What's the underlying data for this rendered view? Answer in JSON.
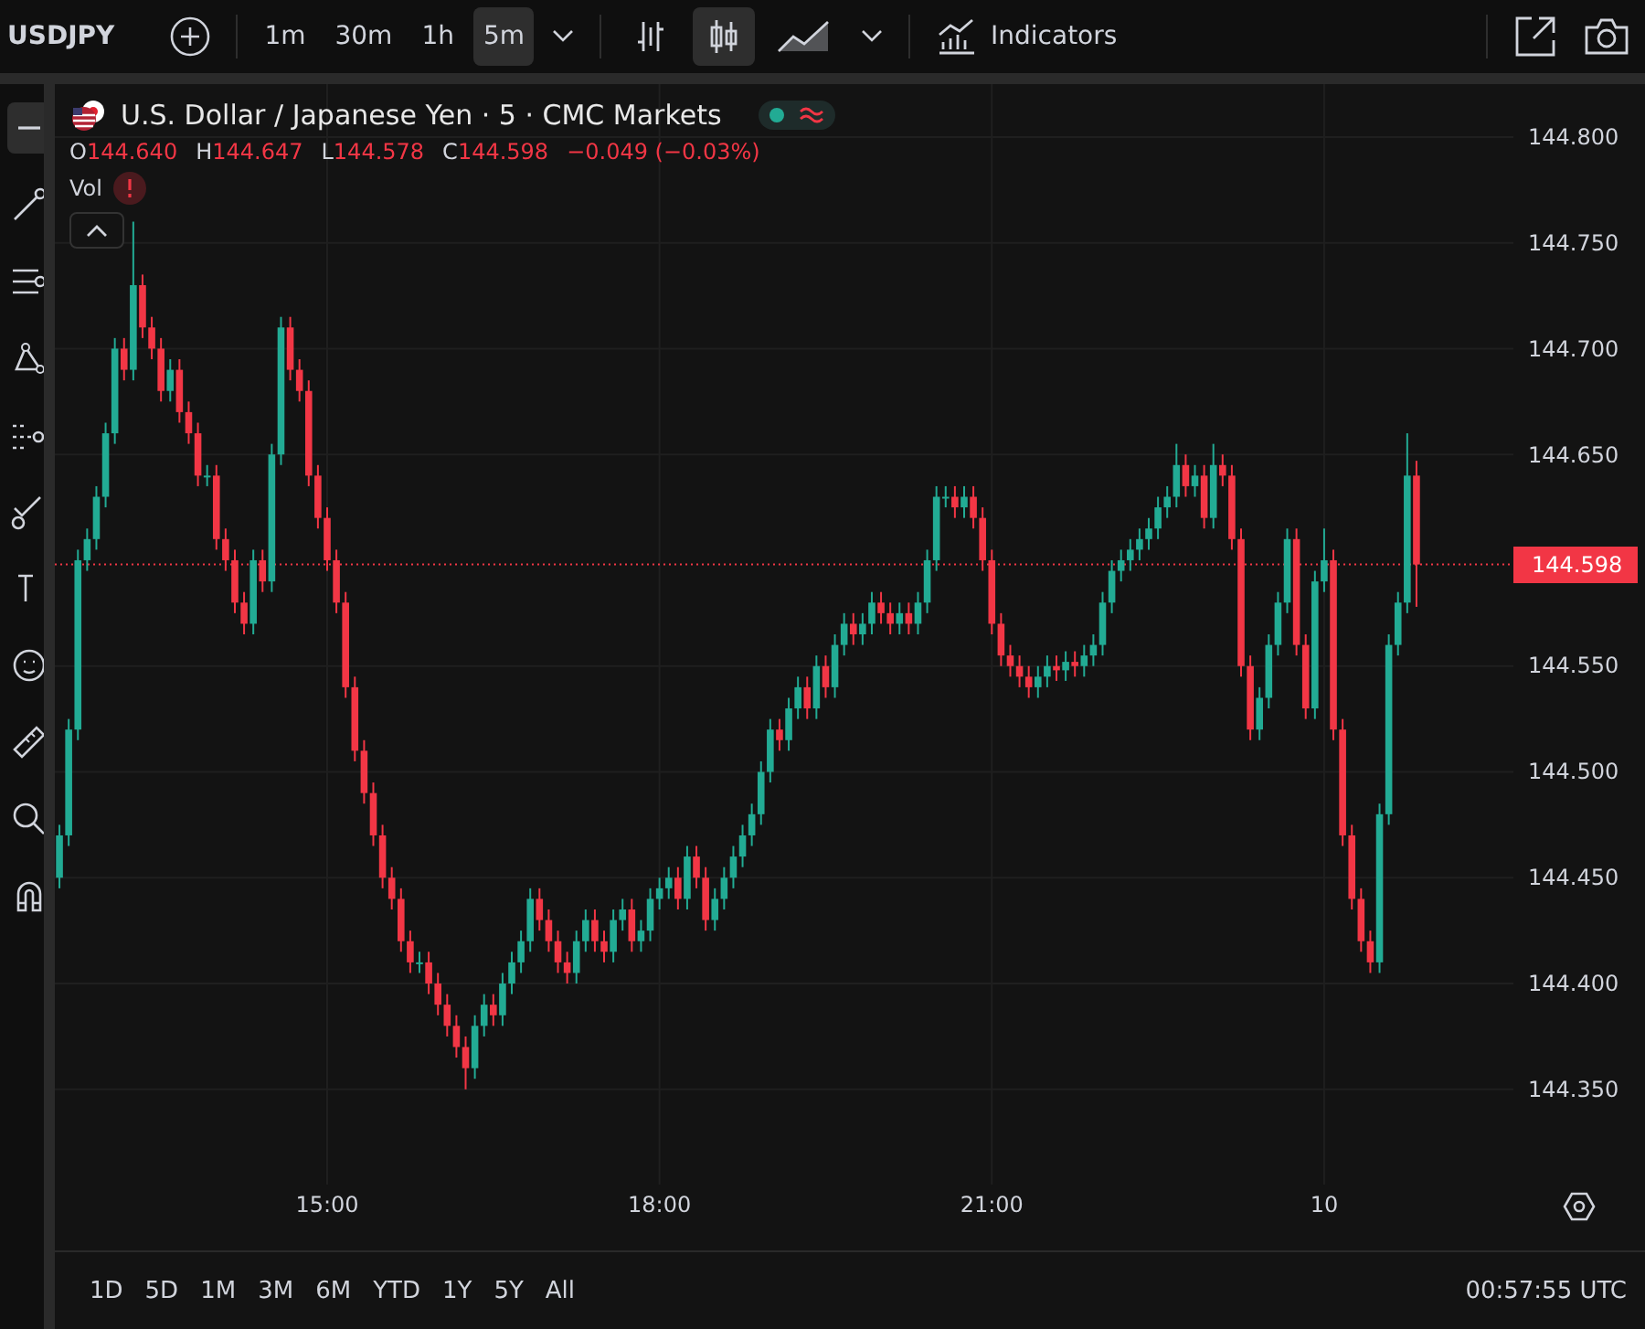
{
  "toolbar": {
    "symbol": "USDJPY",
    "intervals": [
      {
        "label": "1m",
        "selected": false
      },
      {
        "label": "30m",
        "selected": false
      },
      {
        "label": "1h",
        "selected": false
      },
      {
        "label": "5m",
        "selected": true
      }
    ],
    "chart_styles": [
      {
        "kind": "bars",
        "selected": false
      },
      {
        "kind": "candles",
        "selected": true
      },
      {
        "kind": "area",
        "selected": false
      }
    ],
    "indicators_label": "Indicators"
  },
  "sidebar": {
    "tools": [
      {
        "kind": "minus",
        "selected": true
      },
      {
        "kind": "line",
        "selected": false
      },
      {
        "kind": "fib",
        "selected": false
      },
      {
        "kind": "pattern",
        "selected": false
      },
      {
        "kind": "forecast",
        "selected": false
      },
      {
        "kind": "brush",
        "selected": false
      },
      {
        "kind": "text",
        "selected": false
      },
      {
        "kind": "emoji",
        "selected": false
      },
      {
        "kind": "ruler",
        "selected": false
      },
      {
        "kind": "zoom",
        "selected": false
      },
      {
        "kind": "magnet",
        "selected": false
      }
    ]
  },
  "legend": {
    "title": "U.S. Dollar / Japanese Yen · 5 · CMC Markets",
    "ohlc": [
      {
        "label": "O",
        "value": "144.640"
      },
      {
        "label": "H",
        "value": "144.647"
      },
      {
        "label": "L",
        "value": "144.578"
      },
      {
        "label": "C",
        "value": "144.598"
      }
    ],
    "change": "−0.049 (−0.03%)",
    "volume_label": "Vol"
  },
  "chart_data": {
    "type": "candlestick",
    "categories": [
      null,
      null,
      null,
      null,
      null,
      null,
      null,
      null,
      null,
      null,
      null,
      null,
      null,
      null,
      null,
      null,
      null,
      null,
      null,
      null,
      null,
      null,
      null,
      null,
      null,
      null,
      null,
      null,
      null,
      "15:00",
      null,
      null,
      null,
      null,
      null,
      null,
      null,
      null,
      null,
      null,
      null,
      null,
      null,
      null,
      null,
      null,
      null,
      null,
      null,
      null,
      null,
      null,
      null,
      null,
      null,
      null,
      null,
      null,
      null,
      null,
      null,
      null,
      null,
      null,
      null,
      "18:00",
      null,
      null,
      null,
      null,
      null,
      null,
      null,
      null,
      null,
      null,
      null,
      null,
      null,
      null,
      null,
      null,
      null,
      null,
      null,
      null,
      null,
      null,
      null,
      null,
      null,
      null,
      null,
      null,
      null,
      null,
      null,
      null,
      null,
      null,
      null,
      "21:00",
      null,
      null,
      null,
      null,
      null,
      null,
      null,
      null,
      null,
      null,
      null,
      null,
      null,
      null,
      null,
      null,
      null,
      null,
      null,
      null,
      null,
      null,
      null,
      null,
      null,
      null,
      null,
      null,
      null,
      null,
      null,
      null,
      null,
      null,
      null,
      "10",
      null,
      null,
      null,
      null,
      null,
      null,
      null,
      null,
      null,
      null
    ],
    "ohlc": [
      [
        144.45,
        144.475,
        144.445,
        144.47
      ],
      [
        144.47,
        144.525,
        144.465,
        144.52
      ],
      [
        144.52,
        144.605,
        144.515,
        144.6
      ],
      [
        144.6,
        144.615,
        144.595,
        144.61
      ],
      [
        144.61,
        144.635,
        144.605,
        144.63
      ],
      [
        144.63,
        144.665,
        144.625,
        144.66
      ],
      [
        144.66,
        144.705,
        144.655,
        144.7
      ],
      [
        144.7,
        144.705,
        144.685,
        144.69
      ],
      [
        144.69,
        144.76,
        144.685,
        144.73
      ],
      [
        144.73,
        144.735,
        144.705,
        144.71
      ],
      [
        144.71,
        144.715,
        144.695,
        144.7
      ],
      [
        144.7,
        144.705,
        144.675,
        144.68
      ],
      [
        144.68,
        144.695,
        144.675,
        144.69
      ],
      [
        144.69,
        144.695,
        144.665,
        144.67
      ],
      [
        144.67,
        144.675,
        144.655,
        144.66
      ],
      [
        144.66,
        144.665,
        144.635,
        144.64
      ],
      [
        144.64,
        144.645,
        144.635,
        144.64
      ],
      [
        144.64,
        144.645,
        144.605,
        144.61
      ],
      [
        144.61,
        144.615,
        144.595,
        144.6
      ],
      [
        144.6,
        144.605,
        144.575,
        144.58
      ],
      [
        144.58,
        144.585,
        144.565,
        144.57
      ],
      [
        144.57,
        144.605,
        144.565,
        144.6
      ],
      [
        144.6,
        144.605,
        144.585,
        144.59
      ],
      [
        144.59,
        144.655,
        144.585,
        144.65
      ],
      [
        144.65,
        144.715,
        144.645,
        144.71
      ],
      [
        144.71,
        144.715,
        144.685,
        144.69
      ],
      [
        144.69,
        144.695,
        144.675,
        144.68
      ],
      [
        144.68,
        144.685,
        144.635,
        144.64
      ],
      [
        144.64,
        144.645,
        144.615,
        144.62
      ],
      [
        144.62,
        144.625,
        144.595,
        144.6
      ],
      [
        144.6,
        144.605,
        144.575,
        144.58
      ],
      [
        144.58,
        144.585,
        144.535,
        144.54
      ],
      [
        144.54,
        144.545,
        144.505,
        144.51
      ],
      [
        144.51,
        144.515,
        144.485,
        144.49
      ],
      [
        144.49,
        144.495,
        144.465,
        144.47
      ],
      [
        144.47,
        144.475,
        144.445,
        144.45
      ],
      [
        144.45,
        144.455,
        144.435,
        144.44
      ],
      [
        144.44,
        144.445,
        144.415,
        144.42
      ],
      [
        144.42,
        144.425,
        144.405,
        144.41
      ],
      [
        144.41,
        144.415,
        144.405,
        144.41
      ],
      [
        144.41,
        144.415,
        144.395,
        144.4
      ],
      [
        144.4,
        144.405,
        144.385,
        144.39
      ],
      [
        144.39,
        144.395,
        144.375,
        144.38
      ],
      [
        144.38,
        144.385,
        144.365,
        144.37
      ],
      [
        144.37,
        144.375,
        144.35,
        144.36
      ],
      [
        144.36,
        144.385,
        144.355,
        144.38
      ],
      [
        144.38,
        144.395,
        144.375,
        144.39
      ],
      [
        144.39,
        144.395,
        144.38,
        144.385
      ],
      [
        144.385,
        144.405,
        144.38,
        144.4
      ],
      [
        144.4,
        144.415,
        144.395,
        144.41
      ],
      [
        144.41,
        144.425,
        144.405,
        144.42
      ],
      [
        144.42,
        144.445,
        144.415,
        144.44
      ],
      [
        144.44,
        144.445,
        144.425,
        144.43
      ],
      [
        144.43,
        144.435,
        144.415,
        144.42
      ],
      [
        144.42,
        144.425,
        144.405,
        144.41
      ],
      [
        144.41,
        144.415,
        144.4,
        144.405
      ],
      [
        144.405,
        144.425,
        144.4,
        144.42
      ],
      [
        144.42,
        144.435,
        144.415,
        144.43
      ],
      [
        144.43,
        144.435,
        144.415,
        144.42
      ],
      [
        144.42,
        144.425,
        144.41,
        144.415
      ],
      [
        144.415,
        144.435,
        144.41,
        144.43
      ],
      [
        144.43,
        144.44,
        144.425,
        144.435
      ],
      [
        144.435,
        144.44,
        144.415,
        144.42
      ],
      [
        144.42,
        144.43,
        144.415,
        144.425
      ],
      [
        144.425,
        144.445,
        144.42,
        144.44
      ],
      [
        144.44,
        144.45,
        144.435,
        144.445
      ],
      [
        144.445,
        144.455,
        144.44,
        144.45
      ],
      [
        144.45,
        144.455,
        144.435,
        144.44
      ],
      [
        144.44,
        144.465,
        144.435,
        144.46
      ],
      [
        144.46,
        144.465,
        144.445,
        144.45
      ],
      [
        144.45,
        144.455,
        144.425,
        144.43
      ],
      [
        144.43,
        144.445,
        144.425,
        144.44
      ],
      [
        144.44,
        144.455,
        144.435,
        144.45
      ],
      [
        144.45,
        144.465,
        144.445,
        144.46
      ],
      [
        144.46,
        144.475,
        144.455,
        144.47
      ],
      [
        144.47,
        144.485,
        144.465,
        144.48
      ],
      [
        144.48,
        144.505,
        144.475,
        144.5
      ],
      [
        144.5,
        144.525,
        144.495,
        144.52
      ],
      [
        144.52,
        144.525,
        144.51,
        144.515
      ],
      [
        144.515,
        144.535,
        144.51,
        144.53
      ],
      [
        144.53,
        144.545,
        144.525,
        144.54
      ],
      [
        144.54,
        144.545,
        144.525,
        144.53
      ],
      [
        144.53,
        144.555,
        144.525,
        144.55
      ],
      [
        144.55,
        144.555,
        144.535,
        144.54
      ],
      [
        144.54,
        144.565,
        144.535,
        144.56
      ],
      [
        144.56,
        144.575,
        144.555,
        144.57
      ],
      [
        144.57,
        144.575,
        144.56,
        144.565
      ],
      [
        144.565,
        144.575,
        144.56,
        144.57
      ],
      [
        144.57,
        144.585,
        144.565,
        144.58
      ],
      [
        144.58,
        144.585,
        144.57,
        144.575
      ],
      [
        144.575,
        144.58,
        144.565,
        144.57
      ],
      [
        144.57,
        144.58,
        144.565,
        144.575
      ],
      [
        144.575,
        144.58,
        144.565,
        144.57
      ],
      [
        144.57,
        144.585,
        144.565,
        144.58
      ],
      [
        144.58,
        144.605,
        144.575,
        144.6
      ],
      [
        144.6,
        144.635,
        144.595,
        144.63
      ],
      [
        144.63,
        144.635,
        144.625,
        144.63
      ],
      [
        144.63,
        144.635,
        144.62,
        144.625
      ],
      [
        144.625,
        144.635,
        144.62,
        144.63
      ],
      [
        144.63,
        144.635,
        144.615,
        144.62
      ],
      [
        144.62,
        144.625,
        144.595,
        144.6
      ],
      [
        144.6,
        144.605,
        144.565,
        144.57
      ],
      [
        144.57,
        144.575,
        144.55,
        144.555
      ],
      [
        144.555,
        144.56,
        144.545,
        144.55
      ],
      [
        144.55,
        144.555,
        144.54,
        144.545
      ],
      [
        144.545,
        144.55,
        144.535,
        144.54
      ],
      [
        144.54,
        144.55,
        144.535,
        144.545
      ],
      [
        144.545,
        144.555,
        144.54,
        144.55
      ],
      [
        144.55,
        144.555,
        144.543,
        144.548
      ],
      [
        144.548,
        144.557,
        144.543,
        144.552
      ],
      [
        144.552,
        144.557,
        144.545,
        144.55
      ],
      [
        144.55,
        144.56,
        144.545,
        144.555
      ],
      [
        144.555,
        144.565,
        144.55,
        144.56
      ],
      [
        144.56,
        144.585,
        144.555,
        144.58
      ],
      [
        144.58,
        144.6,
        144.575,
        144.595
      ],
      [
        144.595,
        144.605,
        144.59,
        144.6
      ],
      [
        144.6,
        144.61,
        144.595,
        144.605
      ],
      [
        144.605,
        144.615,
        144.6,
        144.61
      ],
      [
        144.61,
        144.62,
        144.605,
        144.615
      ],
      [
        144.615,
        144.63,
        144.61,
        144.625
      ],
      [
        144.625,
        144.635,
        144.62,
        144.63
      ],
      [
        144.63,
        144.655,
        144.625,
        144.645
      ],
      [
        144.645,
        144.65,
        144.63,
        144.635
      ],
      [
        144.635,
        144.645,
        144.63,
        144.64
      ],
      [
        144.64,
        144.645,
        144.615,
        144.62
      ],
      [
        144.62,
        144.655,
        144.615,
        144.645
      ],
      [
        144.645,
        144.65,
        144.635,
        144.64
      ],
      [
        144.64,
        144.645,
        144.605,
        144.61
      ],
      [
        144.61,
        144.615,
        144.545,
        144.55
      ],
      [
        144.55,
        144.555,
        144.515,
        144.52
      ],
      [
        144.52,
        144.54,
        144.515,
        144.535
      ],
      [
        144.535,
        144.565,
        144.53,
        144.56
      ],
      [
        144.56,
        144.585,
        144.555,
        144.58
      ],
      [
        144.58,
        144.615,
        144.575,
        144.61
      ],
      [
        144.61,
        144.615,
        144.555,
        144.56
      ],
      [
        144.56,
        144.565,
        144.525,
        144.53
      ],
      [
        144.53,
        144.595,
        144.525,
        144.59
      ],
      [
        144.59,
        144.615,
        144.585,
        144.6
      ],
      [
        144.6,
        144.605,
        144.515,
        144.52
      ],
      [
        144.52,
        144.525,
        144.465,
        144.47
      ],
      [
        144.47,
        144.475,
        144.435,
        144.44
      ],
      [
        144.44,
        144.445,
        144.415,
        144.42
      ],
      [
        144.42,
        144.425,
        144.405,
        144.41
      ],
      [
        144.41,
        144.485,
        144.405,
        144.48
      ],
      [
        144.48,
        144.565,
        144.475,
        144.56
      ],
      [
        144.56,
        144.585,
        144.555,
        144.58
      ],
      [
        144.58,
        144.66,
        144.575,
        144.64
      ],
      [
        144.64,
        144.647,
        144.578,
        144.598
      ]
    ],
    "grid": true,
    "ref_lines": [
      {
        "axis": "y",
        "value": 144.598,
        "label": "144.598",
        "color": "#f23645"
      }
    ],
    "ylim": [
      144.305,
      144.825
    ],
    "yticks": [
      {
        "value": 144.8,
        "label": "144.800"
      },
      {
        "value": 144.75,
        "label": "144.750"
      },
      {
        "value": 144.7,
        "label": "144.700"
      },
      {
        "value": 144.65,
        "label": "144.650"
      },
      {
        "value": 144.55,
        "label": "144.550"
      },
      {
        "value": 144.5,
        "label": "144.500"
      },
      {
        "value": 144.45,
        "label": "144.450"
      },
      {
        "value": 144.4,
        "label": "144.400"
      },
      {
        "value": 144.35,
        "label": "144.350"
      }
    ]
  },
  "ranges": [
    "1D",
    "5D",
    "1M",
    "3M",
    "6M",
    "YTD",
    "1Y",
    "5Y",
    "All"
  ],
  "clock": "00:57:55 UTC"
}
